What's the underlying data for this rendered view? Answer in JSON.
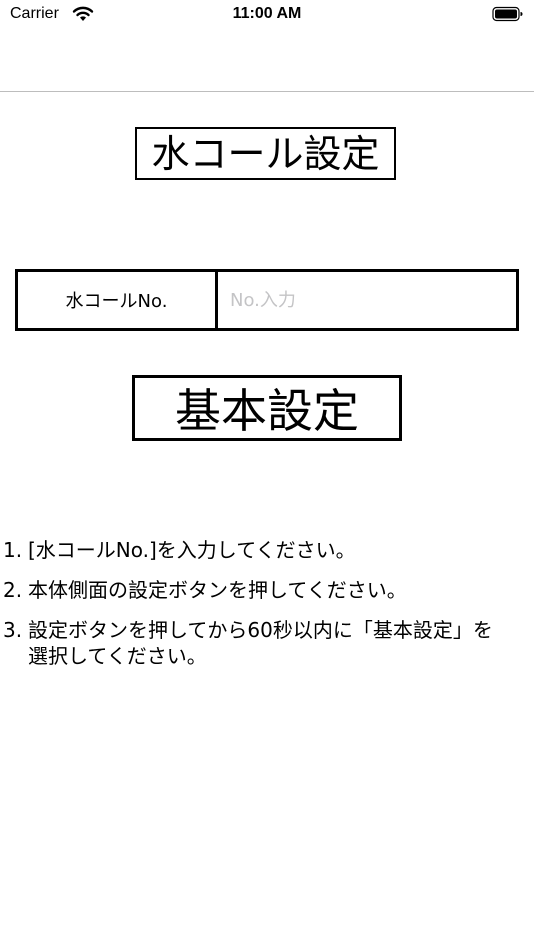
{
  "status_bar": {
    "carrier": "Carrier",
    "time": "11:00 AM",
    "wifi_icon": "wifi-icon",
    "battery_icon": "battery-icon"
  },
  "screen": {
    "title": "水コール設定"
  },
  "input_row": {
    "label": "水コールNo.",
    "placeholder": "No.入力",
    "value": ""
  },
  "basic_button": {
    "label": "基本設定"
  },
  "instructions": [
    {
      "num": "1.",
      "text": "[水コールNo.]を入力してください。"
    },
    {
      "num": "2.",
      "text": "本体側面の設定ボタンを押してください。"
    },
    {
      "num": "3.",
      "text": "設定ボタンを押してから60秒以内に「基本設定」を選択してください。"
    }
  ],
  "colors": {
    "placeholder": "#c4c4c6",
    "divider": "#bdbdbd",
    "border": "#000000"
  }
}
